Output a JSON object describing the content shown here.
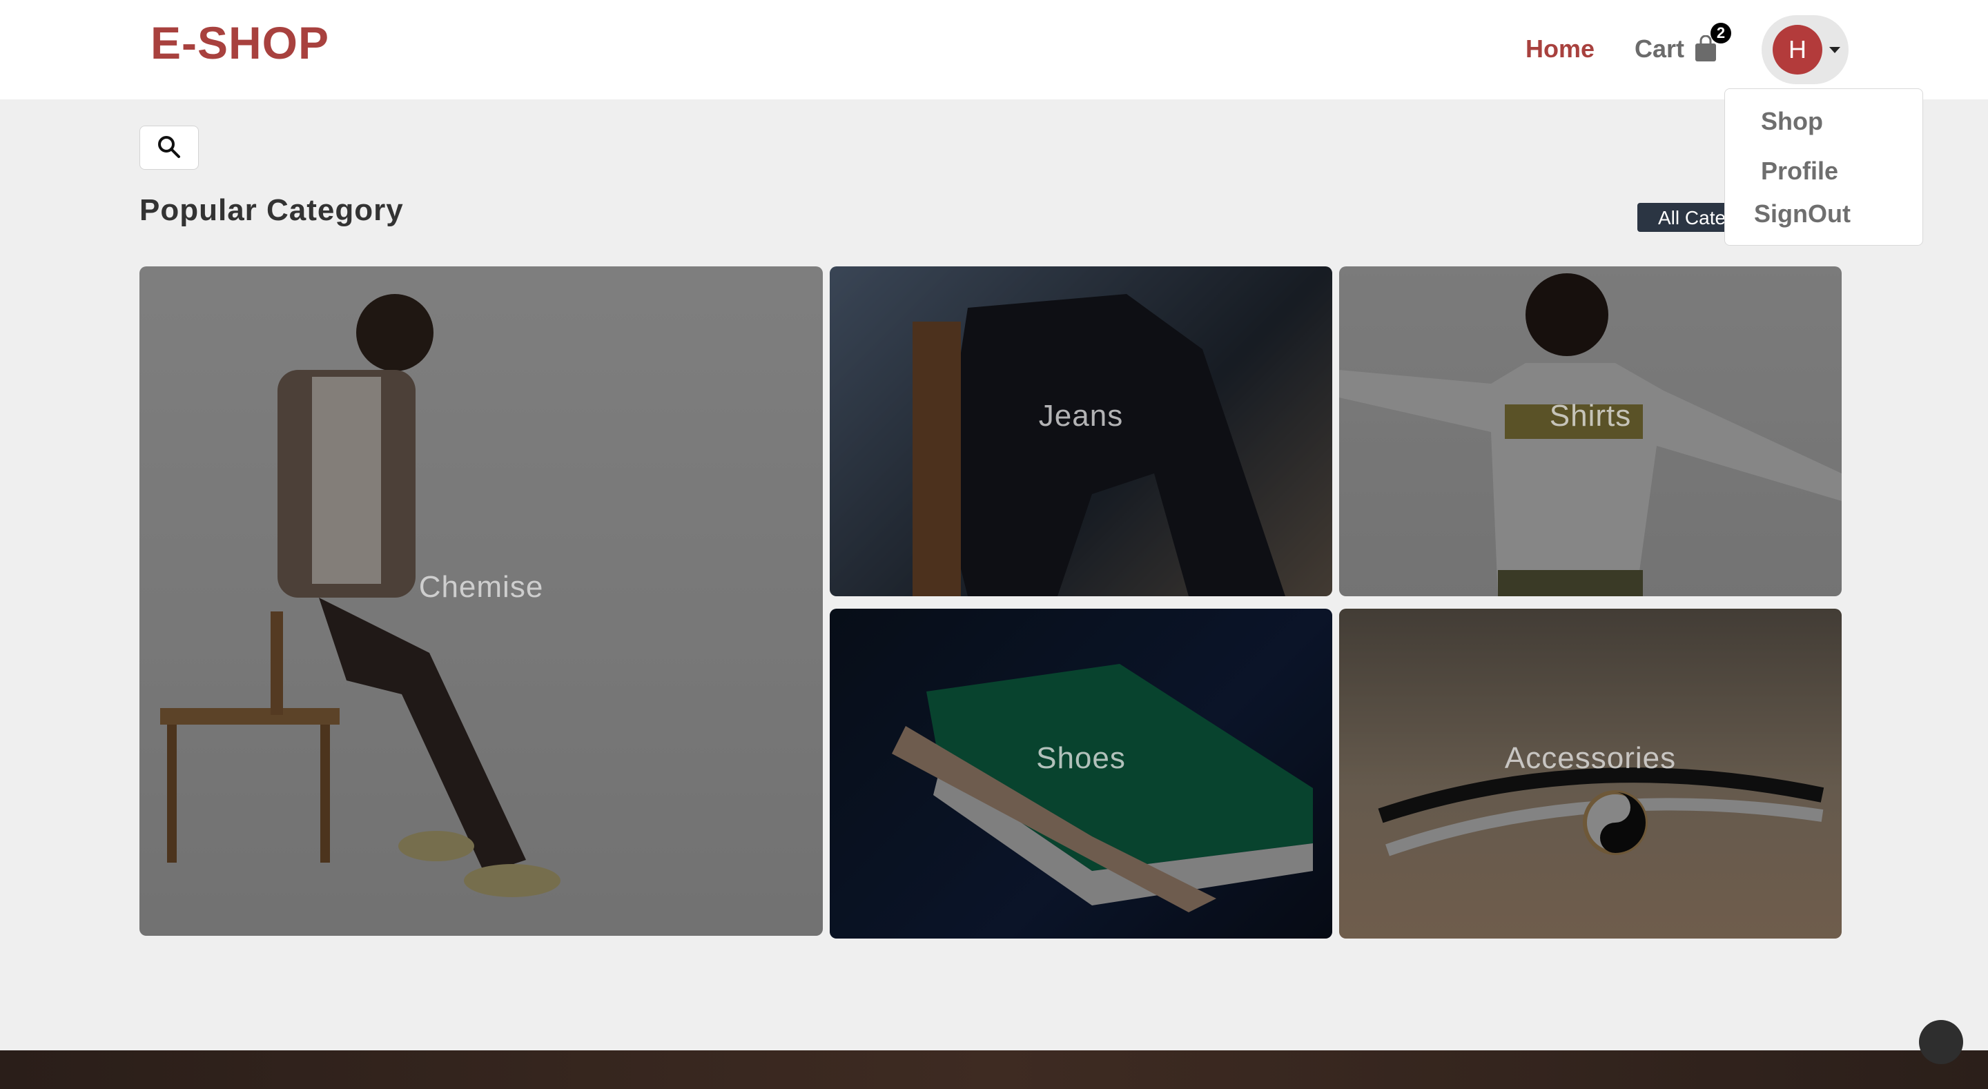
{
  "brand": {
    "name": "E-SHOP",
    "color": "#a8413e"
  },
  "nav": {
    "home_label": "Home",
    "cart_label": "Cart",
    "cart_count": "2",
    "cart_icon": "shopping-bag-icon",
    "avatar_initial": "H"
  },
  "user_menu": {
    "items": [
      {
        "label": "Shop"
      },
      {
        "label": "Profile"
      },
      {
        "label": "SignOut"
      }
    ]
  },
  "search": {
    "icon": "search-icon"
  },
  "section": {
    "title": "Popular Category",
    "all_button_label": "All Cate"
  },
  "categories": [
    {
      "label": "Chemise"
    },
    {
      "label": "Jeans"
    },
    {
      "label": "Shirts"
    },
    {
      "label": "Shoes"
    },
    {
      "label": "Accessories"
    }
  ],
  "colors": {
    "accent": "#a8413e",
    "avatar_bg": "#b33b3b",
    "dark_button": "#2b3543"
  }
}
